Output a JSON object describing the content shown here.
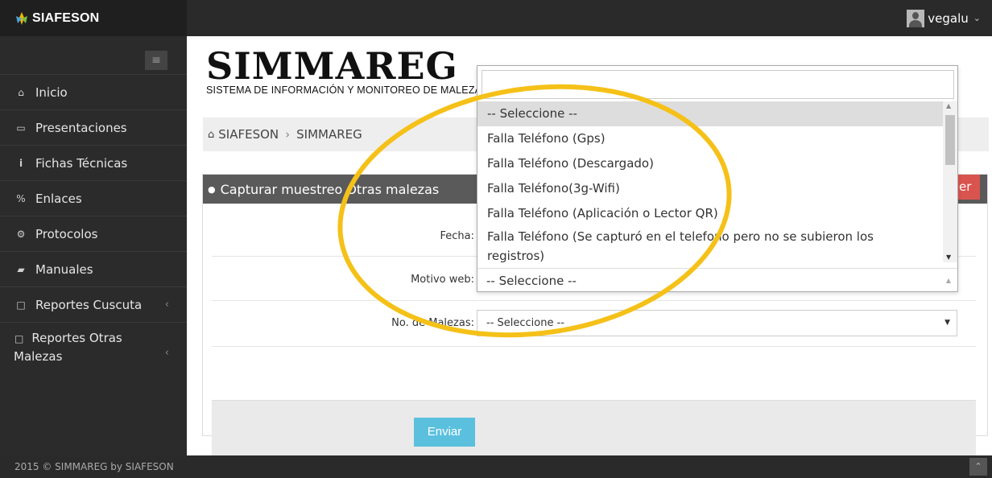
{
  "brand": {
    "name": "SIAFESON"
  },
  "user": {
    "name": "vegalu"
  },
  "sidebar": {
    "items": [
      {
        "label": "Inicio",
        "icon": "home-icon",
        "glyph": "⌂"
      },
      {
        "label": "Presentaciones",
        "icon": "folder-icon",
        "glyph": "▭"
      },
      {
        "label": "Fichas Técnicas",
        "icon": "info-icon",
        "glyph": "i"
      },
      {
        "label": "Enlaces",
        "icon": "link-icon",
        "glyph": "%"
      },
      {
        "label": "Protocolos",
        "icon": "gear-icon",
        "glyph": "⚙"
      },
      {
        "label": "Manuales",
        "icon": "book-icon",
        "glyph": "▰"
      },
      {
        "label": "Reportes Cuscuta",
        "icon": "document-icon",
        "glyph": "□"
      },
      {
        "label_line1": "Reportes Otras",
        "label_line2": "Malezas",
        "icon": "document-icon",
        "glyph": "□"
      }
    ]
  },
  "logo": {
    "title": "SIMMAREG",
    "subtitle": "SISTEMA DE INFORMACIÓN Y MONITOREO DE MALEZAS"
  },
  "breadcrumb": {
    "home": "SIAFESON",
    "current": "SIMMAREG",
    "separator": "›"
  },
  "panel": {
    "title": "Capturar muestreo Otras malezas",
    "action_button_fragment": "er"
  },
  "form": {
    "fecha_label": "Fecha:",
    "motivo_label": "Motivo web:",
    "malezas_label": "No. de Malezas:",
    "malezas_value": "-- Seleccione --",
    "submit_label": "Enviar"
  },
  "dropdown": {
    "options": [
      "-- Seleccione --",
      "Falla Teléfono (Gps)",
      "Falla Teléfono (Descargado)",
      "Falla Teléfono(3g-Wifi)",
      "Falla Teléfono (Aplicación o Lector QR)"
    ],
    "option_long_line1": "Falla Teléfono (Se capturó en el telefono pero no se subieron los",
    "option_long_line2": "registros)",
    "current_value": "-- Seleccione --"
  },
  "footer": {
    "text": "2015 © SIMMAREG by SIAFESON"
  },
  "colors": {
    "topbar": "#2a2a2a",
    "sidebar": "#2b2b2b",
    "panel_header": "#5a5a5a",
    "submit_button": "#5bc0de",
    "danger_button": "#d9534f",
    "highlight": "#f5c118"
  }
}
